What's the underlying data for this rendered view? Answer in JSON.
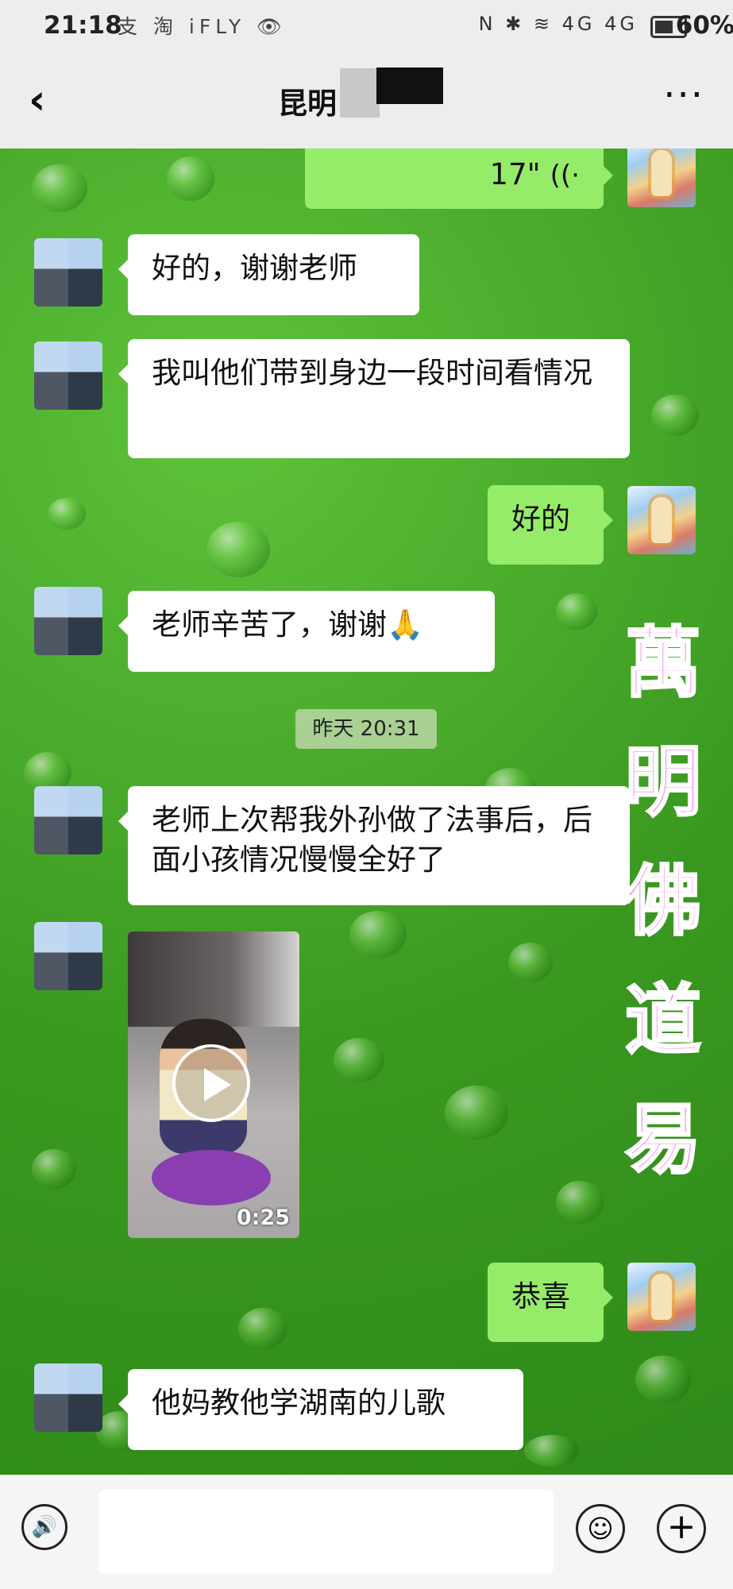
{
  "status_bar": {
    "time": "21:18",
    "left_icons": "支 淘 iFLY 👁",
    "right_icons": "N ✱ ≋ 4G 4G",
    "battery": "60%"
  },
  "header": {
    "back_icon": "‹",
    "title": "昆明",
    "more_icon": "···"
  },
  "chat": {
    "voice_message": {
      "duration": "17\"",
      "icon": "((·"
    },
    "msg1": "好的，谢谢老师",
    "msg2": "我叫他们带到身边一段时间看情况",
    "msg3": "好的",
    "msg4": "老师辛苦了，谢谢🙏",
    "timestamp": "昨天 20:31",
    "msg5": "老师上次帮我外孙做了法事后，后面小孩情况慢慢全好了",
    "video": {
      "duration": "0:25"
    },
    "msg6": "恭喜",
    "msg7": "他妈教他学湖南的儿歌"
  },
  "watermark": [
    "萬",
    "明",
    "佛",
    "道",
    "易"
  ],
  "input_bar": {
    "voice_icon": "🔊",
    "emoji_icon": "☺",
    "plus_icon": "+"
  },
  "colors": {
    "outgoing_bubble": "#95ec69",
    "incoming_bubble": "#ffffff",
    "chat_background": "#3f9d23",
    "watermark": "#e88be0"
  }
}
